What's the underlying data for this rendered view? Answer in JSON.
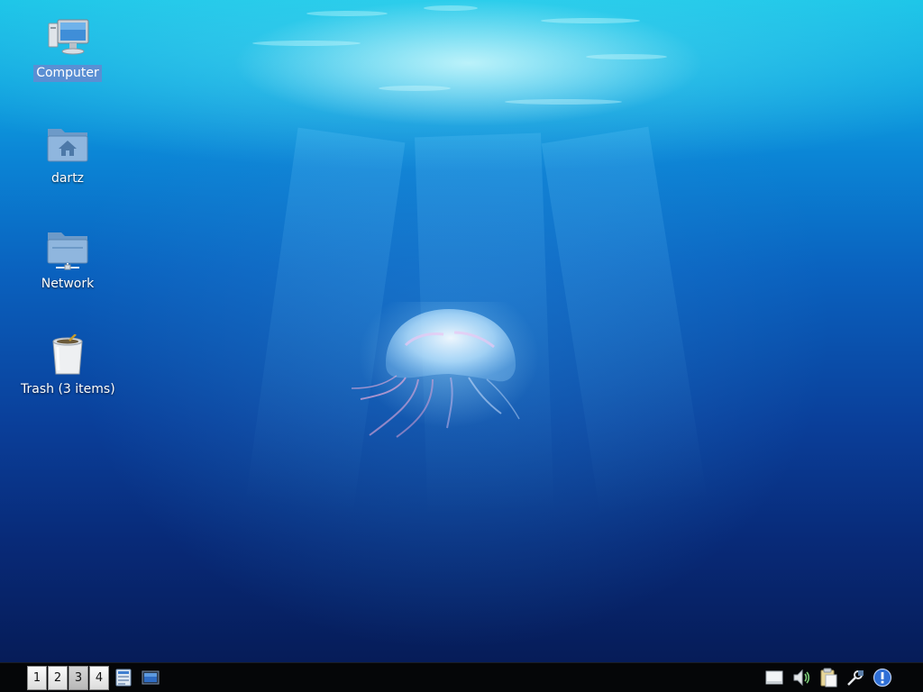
{
  "desktop": {
    "icons": [
      {
        "label": "Computer",
        "icon": "computer-icon",
        "selected": true
      },
      {
        "label": "dartz",
        "icon": "home-folder-icon",
        "selected": false
      },
      {
        "label": "Network",
        "icon": "network-folder-icon",
        "selected": false
      },
      {
        "label": "Trash (3 items)",
        "icon": "trash-icon",
        "selected": false
      }
    ],
    "wallpaper": "underwater jellyfish",
    "colors": {
      "selection": "#5a8fd3",
      "panel": "#050608"
    }
  },
  "panel": {
    "workspaces": [
      "1",
      "2",
      "3",
      "4"
    ],
    "active_workspace": "3",
    "launchers": [
      {
        "icon": "window-list-icon"
      },
      {
        "icon": "show-desktop-icon"
      }
    ],
    "tray": [
      {
        "icon": "removable-drive-icon"
      },
      {
        "icon": "volume-icon"
      },
      {
        "icon": "clipboard-icon"
      },
      {
        "icon": "network-tool-icon"
      },
      {
        "icon": "update-notification-icon"
      }
    ]
  }
}
